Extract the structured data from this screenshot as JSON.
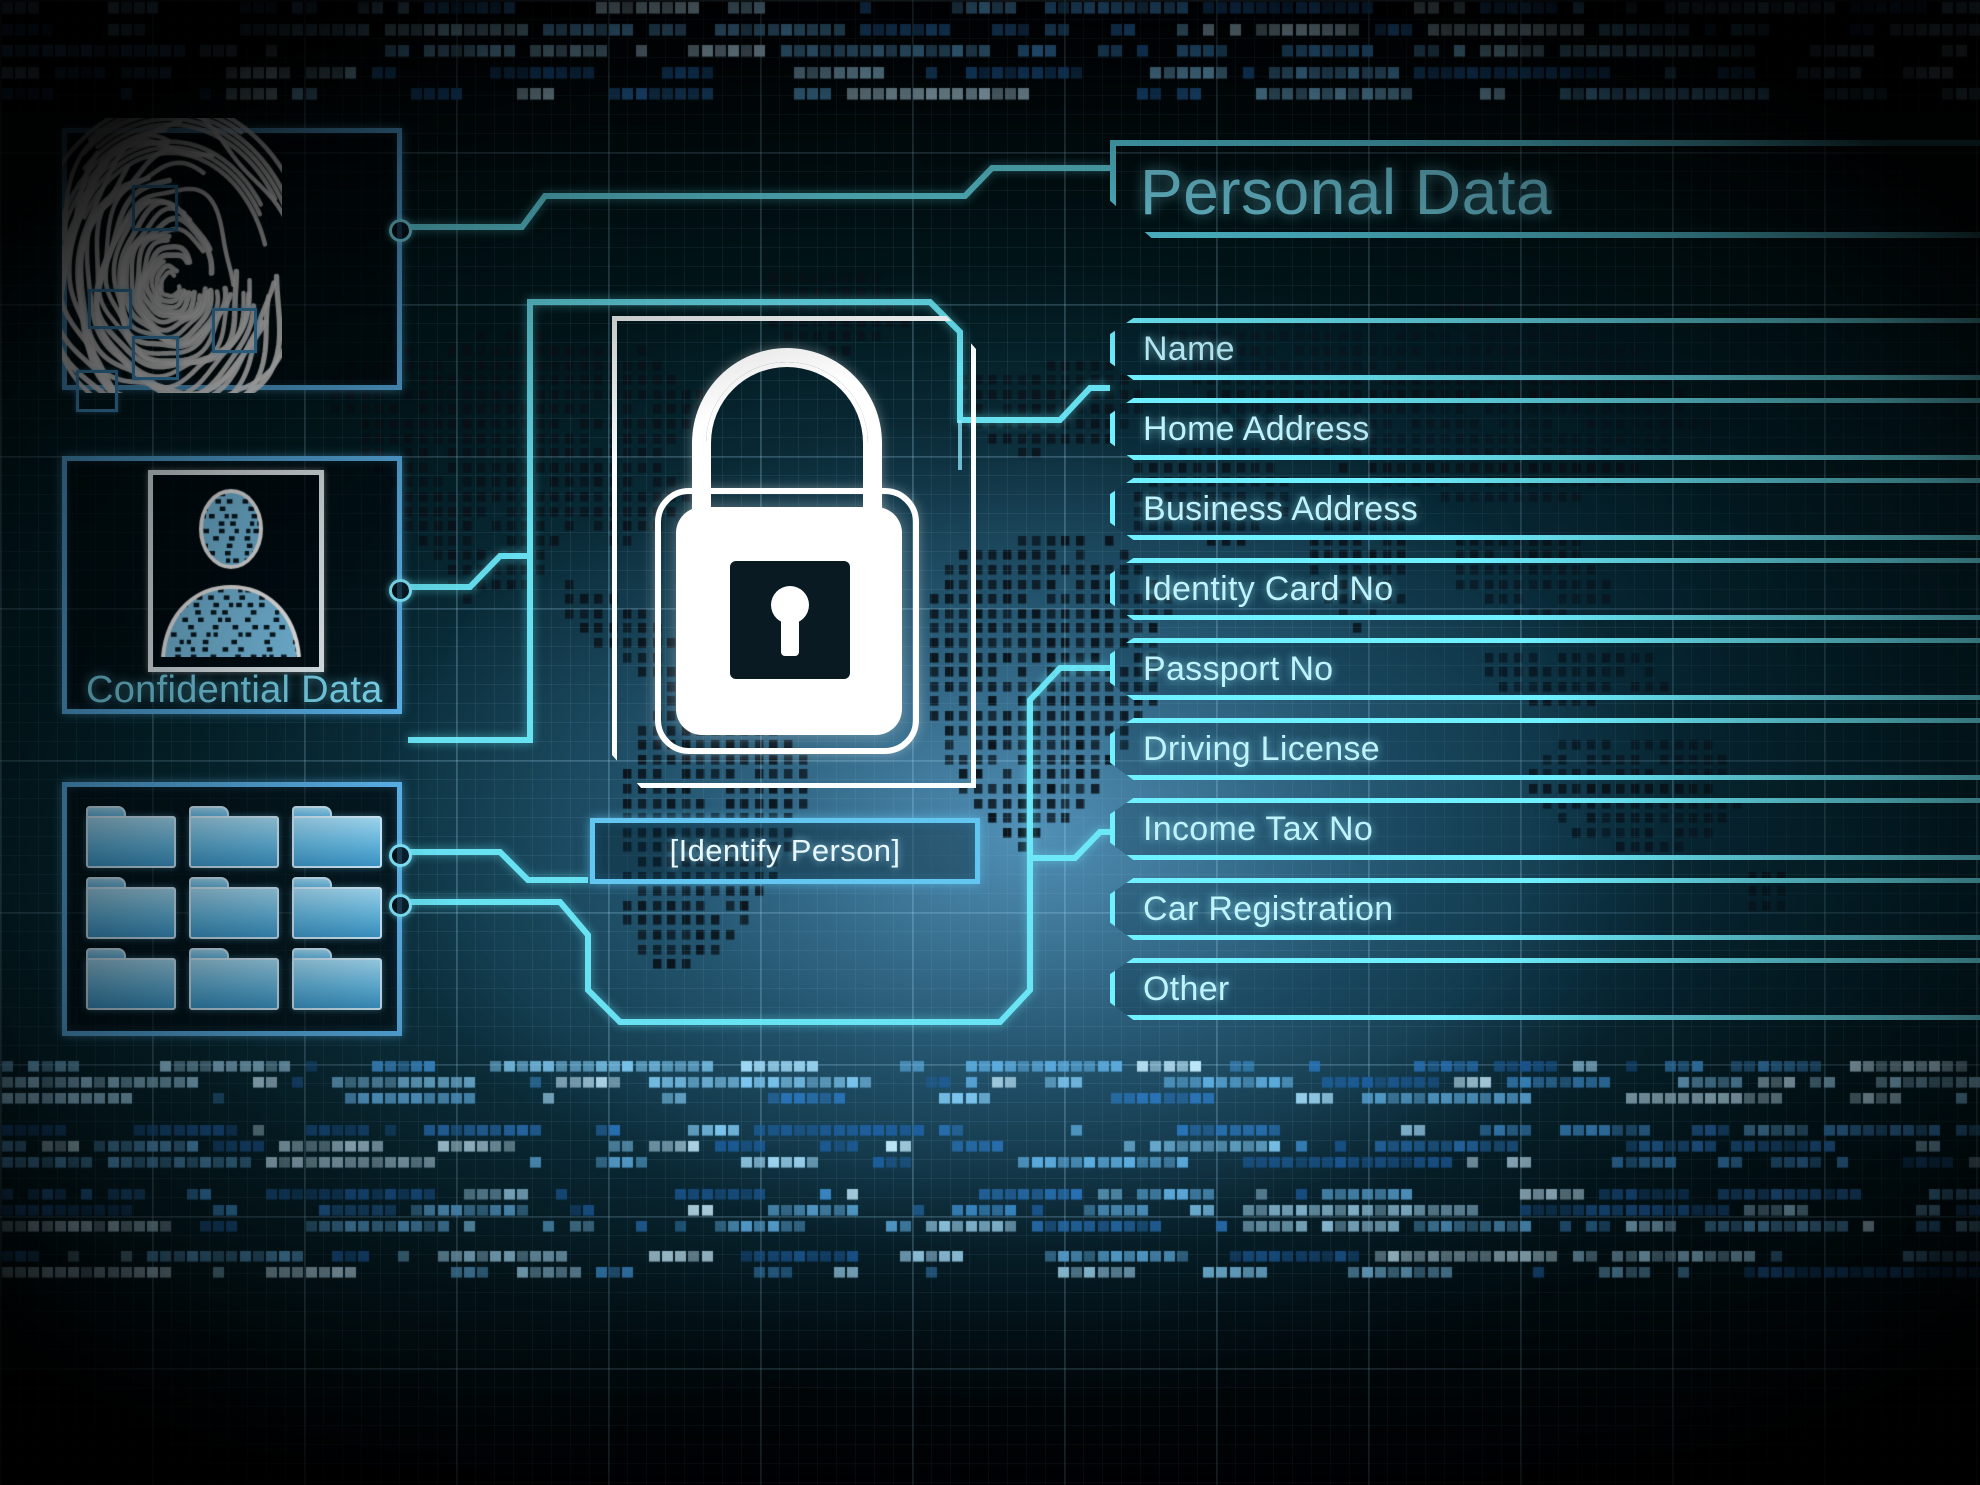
{
  "header": {
    "title": "Personal Data"
  },
  "left_panels": {
    "fingerprint_panel": {
      "icon": "fingerprint-icon",
      "minutiae_count": 5
    },
    "confidential_panel": {
      "icon": "person-avatar-icon",
      "label": "Confidential Data"
    },
    "folders_panel": {
      "icon": "folder-icon",
      "folder_count": 9
    }
  },
  "center": {
    "lock_icon": "padlock-icon",
    "action_label": "[Identify Person]"
  },
  "data_list": {
    "items": [
      {
        "label": "Name"
      },
      {
        "label": "Home Address"
      },
      {
        "label": "Business Address"
      },
      {
        "label": "Identity Card No"
      },
      {
        "label": "Passport No"
      },
      {
        "label": "Driving License"
      },
      {
        "label": "Income Tax No"
      },
      {
        "label": "Car Registration"
      },
      {
        "label": "Other"
      }
    ]
  },
  "colors": {
    "accent_cyan": "#6ff0ff",
    "panel_blue": "#5bb4ec",
    "title_cyan": "#7fe6fb",
    "lock_white": "#ffffff",
    "background_deep": "#021018",
    "map_dot": "#0a141c"
  },
  "decor": {
    "binary_strip_top": "binary-data-strip",
    "binary_strip_bottom": "binary-data-strip",
    "world_map": "dotted-world-map",
    "grid": "technical-grid"
  }
}
